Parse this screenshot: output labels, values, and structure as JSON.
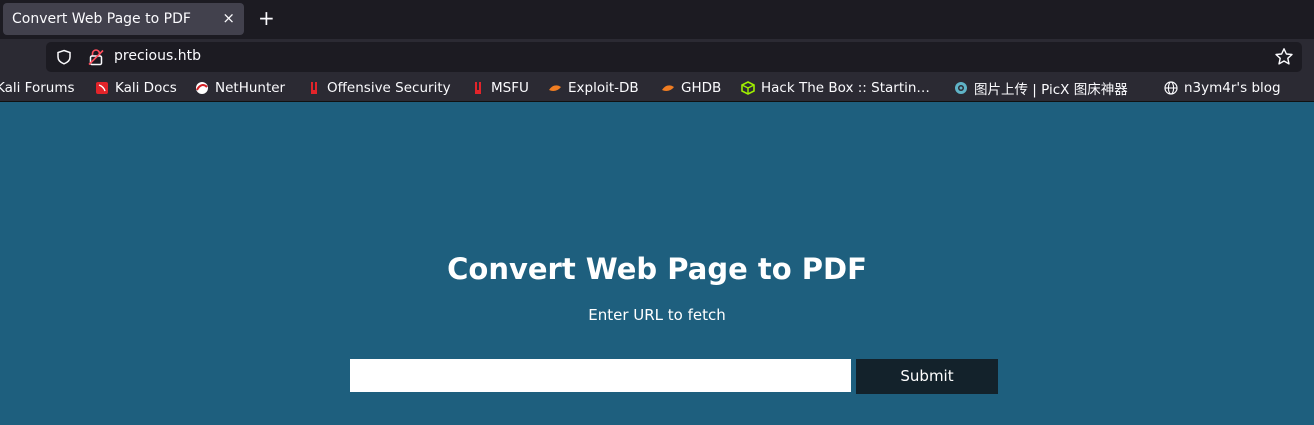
{
  "browser": {
    "tab": {
      "title": "Convert Web Page to PDF",
      "close_glyph": "×"
    },
    "new_tab_glyph": "+",
    "address": "precious.htb",
    "bookmarks": [
      {
        "label": "Kali Forums",
        "icon": "kali-icon"
      },
      {
        "label": "Kali Docs",
        "icon": "kali-docs-icon"
      },
      {
        "label": "NetHunter",
        "icon": "nethunter-icon"
      },
      {
        "label": "Offensive Security",
        "icon": "offsec-icon"
      },
      {
        "label": "MSFU",
        "icon": "msfu-icon"
      },
      {
        "label": "Exploit-DB",
        "icon": "exploitdb-icon"
      },
      {
        "label": "GHDB",
        "icon": "ghdb-icon"
      },
      {
        "label": "Hack The Box :: Startin…",
        "icon": "htb-cube-icon"
      },
      {
        "label": "图片上传 | PicX 图床神器",
        "icon": "picx-icon"
      },
      {
        "label": "n3ym4r's blog",
        "icon": "globe-icon"
      }
    ]
  },
  "page": {
    "title": "Convert Web Page to PDF",
    "subtitle": "Enter URL to fetch",
    "url_input_value": "",
    "submit_label": "Submit"
  },
  "colors": {
    "page_background": "#1e5f7e",
    "submit_background": "#13222b",
    "browser_dark": "#1c1b22",
    "browser_toolbar": "#2b2a33"
  }
}
